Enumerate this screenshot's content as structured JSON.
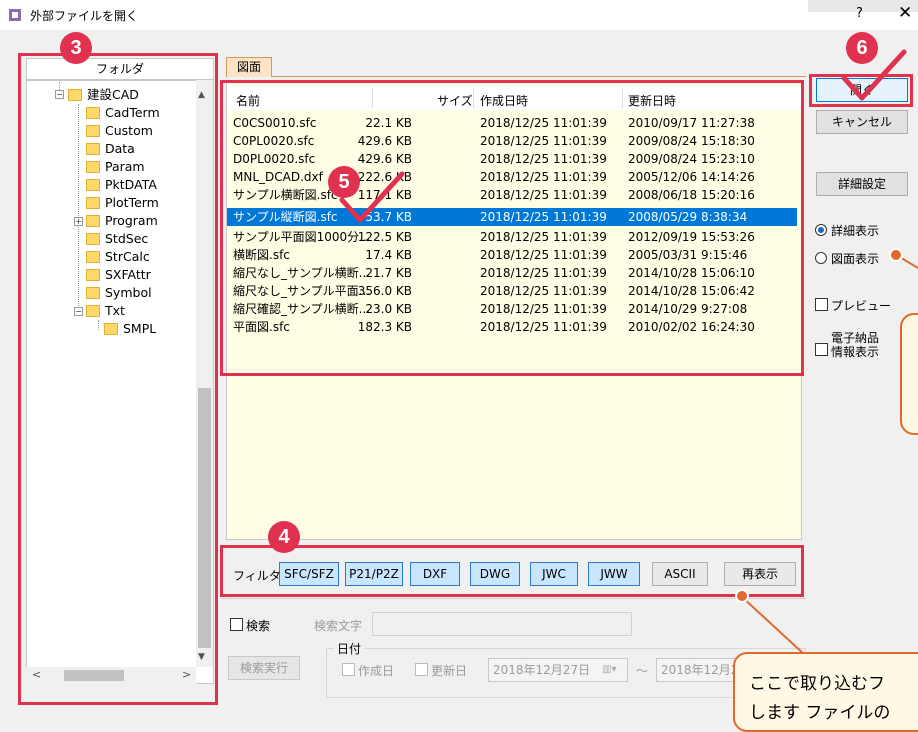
{
  "window": {
    "title": "外部ファイルを開く",
    "help_label": "?",
    "close_label": "✕"
  },
  "folder_panel": {
    "header": "フォルダ",
    "items": [
      {
        "label": "建設CAD",
        "expanded": true
      },
      {
        "label": "CadTerm"
      },
      {
        "label": "Custom"
      },
      {
        "label": "Data"
      },
      {
        "label": "Param"
      },
      {
        "label": "PktDATA"
      },
      {
        "label": "PlotTerm"
      },
      {
        "label": "Program",
        "collapsed": true
      },
      {
        "label": "StdSec"
      },
      {
        "label": "StrCalc"
      },
      {
        "label": "SXFAttr"
      },
      {
        "label": "Symbol"
      },
      {
        "label": "Txt",
        "expanded": true
      },
      {
        "label": "SMPL"
      }
    ],
    "expand_minus": "−",
    "expand_plus": "+",
    "scroll_up": "▲",
    "scroll_down": "▼",
    "scroll_left": "<",
    "scroll_right": ">"
  },
  "tabs": [
    {
      "label": "図面",
      "active": true
    }
  ],
  "file_list": {
    "columns": {
      "name": "名前",
      "size": "サイズ",
      "created": "作成日時",
      "updated": "更新日時"
    },
    "rows": [
      {
        "name": "C0CS0010.sfc",
        "size": "22.1 KB",
        "created": "2018/12/25 11:01:39",
        "updated": "2010/09/17 11:27:38"
      },
      {
        "name": "C0PL0020.sfc",
        "size": "429.6 KB",
        "created": "2018/12/25 11:01:39",
        "updated": "2009/08/24 15:18:30"
      },
      {
        "name": "D0PL0020.sfc",
        "size": "429.6 KB",
        "created": "2018/12/25 11:01:39",
        "updated": "2009/08/24 15:23:10"
      },
      {
        "name": "MNL_DCAD.dxf",
        "size": "222.6 KB",
        "created": "2018/12/25 11:01:39",
        "updated": "2005/12/06 14:14:26"
      },
      {
        "name": "サンプル横断図.sfc",
        "size": "117.1 KB",
        "created": "2018/12/25 11:01:39",
        "updated": "2008/06/18 15:20:16"
      },
      {
        "name": "サンプル縦断図.sfc",
        "size": "53.7 KB",
        "created": "2018/12/25 11:01:39",
        "updated": "2008/05/29 8:38:34",
        "selected": true
      },
      {
        "name": "サンプル平面図1000分...",
        "size": "122.5 KB",
        "created": "2018/12/25 11:01:39",
        "updated": "2012/09/19 15:53:26"
      },
      {
        "name": "横断図.sfc",
        "size": "17.4 KB",
        "created": "2018/12/25 11:01:39",
        "updated": "2005/03/31 9:15:46"
      },
      {
        "name": "縮尺なし_サンプル横断...",
        "size": "21.7 KB",
        "created": "2018/12/25 11:01:39",
        "updated": "2014/10/28 15:06:10"
      },
      {
        "name": "縮尺なし_サンプル平面...",
        "size": "356.0 KB",
        "created": "2018/12/25 11:01:39",
        "updated": "2014/10/28 15:06:42"
      },
      {
        "name": "縮尺確認_サンプル横断...",
        "size": "23.0 KB",
        "created": "2018/12/25 11:01:39",
        "updated": "2014/10/29 9:27:08"
      },
      {
        "name": "平面図.sfc",
        "size": "182.3 KB",
        "created": "2018/12/25 11:01:39",
        "updated": "2010/02/02 16:24:30"
      }
    ]
  },
  "filter": {
    "label": "フィルタ",
    "buttons": [
      "SFC/SFZ",
      "P21/P2Z",
      "DXF",
      "DWG",
      "JWC",
      "JWW",
      "ASCII"
    ],
    "reshow": "再表示"
  },
  "search": {
    "checkbox_label": "検索",
    "text_label": "検索文字",
    "exec_button": "検索実行",
    "date_label": "日付",
    "created_label": "作成日",
    "updated_label": "更新日",
    "date_from": "2018年12月27日",
    "tilde": "～",
    "date_to": "2018年12月2"
  },
  "right_panel": {
    "open": "開く",
    "cancel": "キャンセル",
    "detail_settings": "詳細設定",
    "view_detail": "詳細表示",
    "view_drawing": "図面表示",
    "preview": "プレビュー",
    "e_delivery_1": "電子納品",
    "e_delivery_2": "情報表示"
  },
  "annotations": {
    "badges": [
      "3",
      "4",
      "5",
      "6"
    ],
    "callout_bottom": "ここで取り込むフ",
    "callout_bottom_2": "します ファイルの"
  },
  "colors": {
    "accent_red": "#e0314e",
    "callout_orange": "#e06a2e",
    "selection_blue": "#0078d7",
    "list_bg": "#fffde3"
  }
}
